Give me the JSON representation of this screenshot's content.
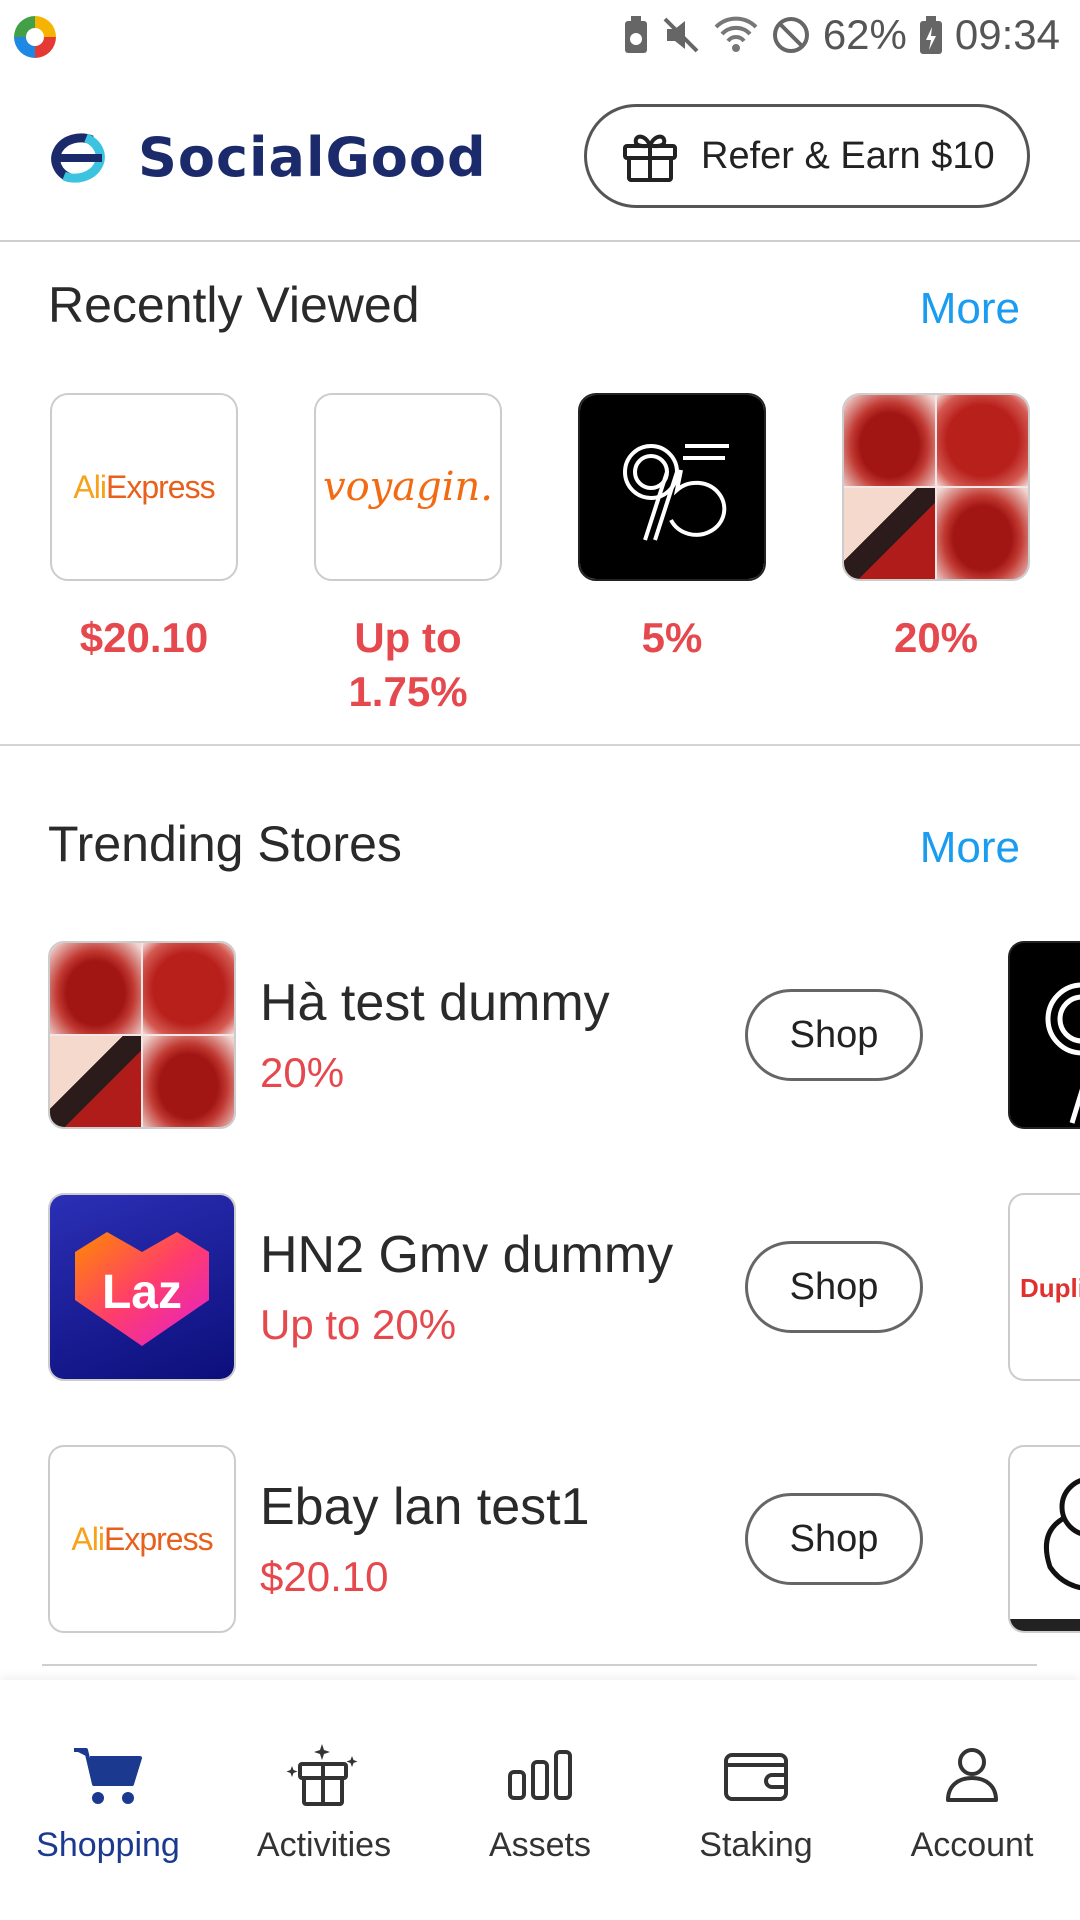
{
  "status_bar": {
    "battery": "62%",
    "time": "09:34"
  },
  "header": {
    "brand": "SocialGood",
    "refer_label": "Refer & Earn $10"
  },
  "recently_viewed": {
    "title": "Recently Viewed",
    "more_label": "More",
    "items": [
      {
        "logo": "AliExpress",
        "value": "$20.10"
      },
      {
        "logo": "voyagin",
        "value": "Up to 1.75%"
      },
      {
        "logo": "95",
        "value": "5%"
      },
      {
        "logo": "lipstick-swatches",
        "value": "20%"
      }
    ]
  },
  "trending_stores": {
    "title": "Trending Stores",
    "more_label": "More",
    "shop_label": "Shop",
    "items": [
      {
        "name": "Hà test dummy",
        "rate": "20%",
        "logo": "lipstick-swatches"
      },
      {
        "name": "HN2 Gmv dummy",
        "rate": "Up to 20%",
        "logo": "Laz"
      },
      {
        "name": "Ebay lan test1",
        "rate": "$20.10",
        "logo": "AliExpress"
      }
    ],
    "peek_logo": "Duplic"
  },
  "bottom_nav": [
    {
      "label": "Shopping",
      "icon": "cart-icon",
      "active": true
    },
    {
      "label": "Activities",
      "icon": "gift-box-sparkle-icon",
      "active": false
    },
    {
      "label": "Assets",
      "icon": "bar-chart-icon",
      "active": false
    },
    {
      "label": "Staking",
      "icon": "wallet-icon",
      "active": false
    },
    {
      "label": "Account",
      "icon": "person-icon",
      "active": false
    }
  ],
  "colors": {
    "accent_link": "#1a9cf0",
    "value_red": "#e5484d",
    "brand_navy": "#1b2a6b",
    "active_nav": "#1b3a8f"
  }
}
